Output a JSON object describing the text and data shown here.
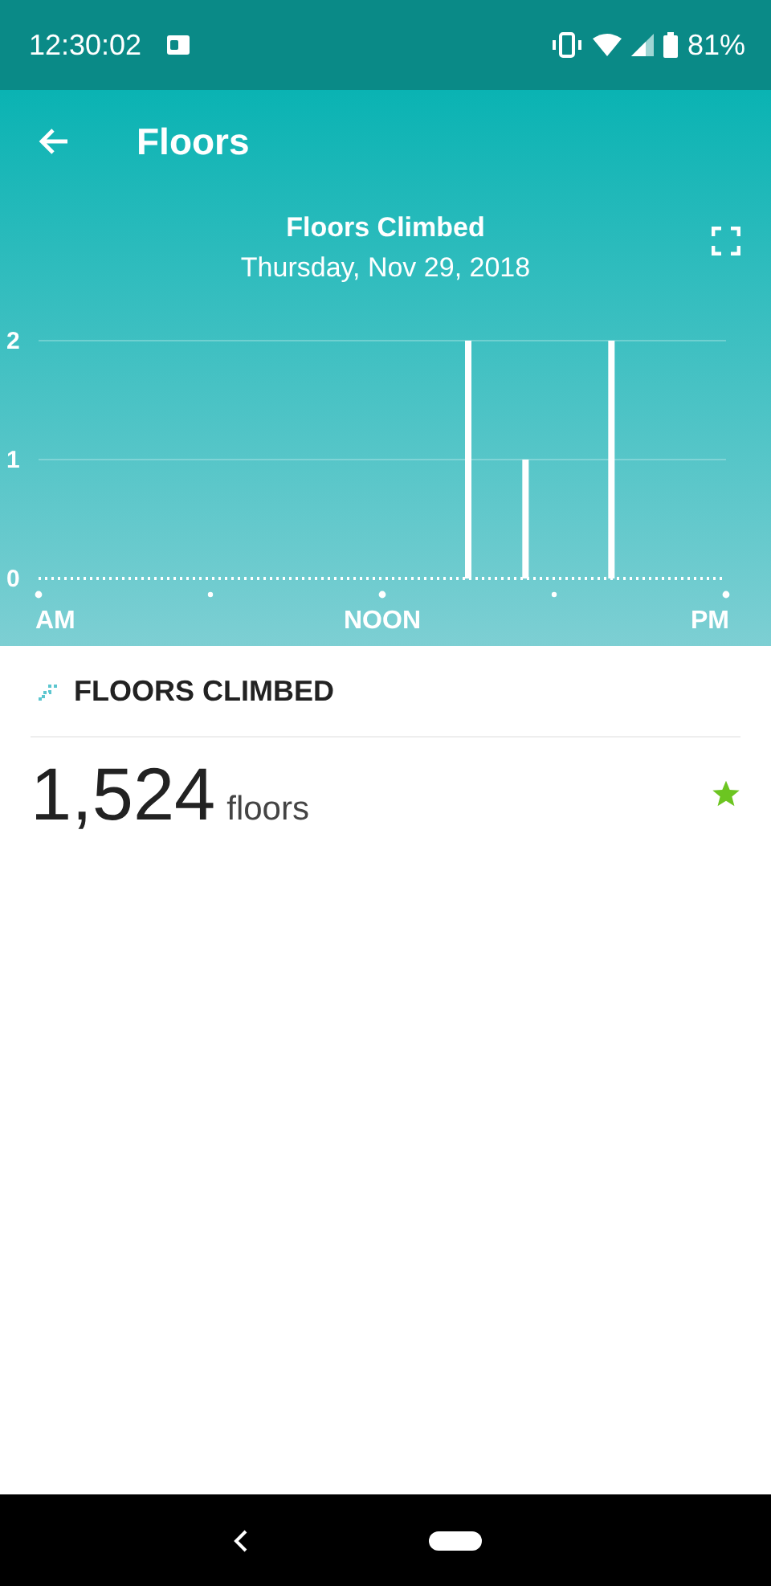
{
  "status_bar": {
    "time": "12:30:02",
    "battery": "81%"
  },
  "app_bar": {
    "title": "Floors"
  },
  "chart": {
    "title": "Floors Climbed",
    "date": "Thursday, Nov 29, 2018",
    "chart_data": {
      "type": "bar",
      "categories": [
        "AM",
        null,
        null,
        null,
        null,
        null,
        null,
        null,
        null,
        null,
        null,
        null,
        "NOON",
        null,
        null,
        null,
        null,
        null,
        null,
        null,
        null,
        null,
        null,
        null,
        "PM"
      ],
      "values": [
        0,
        0,
        0,
        0,
        0,
        0,
        0,
        0,
        0,
        0,
        0,
        0,
        0,
        0,
        0,
        2,
        0,
        1,
        0,
        0,
        2,
        0,
        0,
        0,
        0
      ],
      "ylim": [
        0,
        2
      ],
      "yticks": [
        0,
        1,
        2
      ]
    }
  },
  "summary": {
    "heading": "FLOORS CLIMBED",
    "value": "1,524",
    "unit": "floors",
    "goal_met": true
  }
}
